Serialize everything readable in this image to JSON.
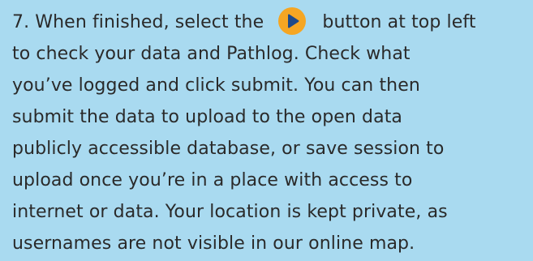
{
  "instruction": {
    "line1_before_icon": "7. When finished, select the",
    "line1_after_icon": "button at top left",
    "lines": [
      "to check your data and Pathlog. Check what",
      "you’ve logged and click submit. You can then",
      "submit the data to upload to the open data",
      "publicly accessible database, or save session to",
      "upload once you’re in a place with access to",
      "internet or data. Your location is kept private, as",
      "usernames are not visible in our online map."
    ]
  },
  "icon": {
    "name": "play-icon",
    "color": "#f5a623",
    "glyph_color": "#1e4a8a"
  },
  "colors": {
    "background": "#a9daf0",
    "text": "#2a2a2a"
  }
}
